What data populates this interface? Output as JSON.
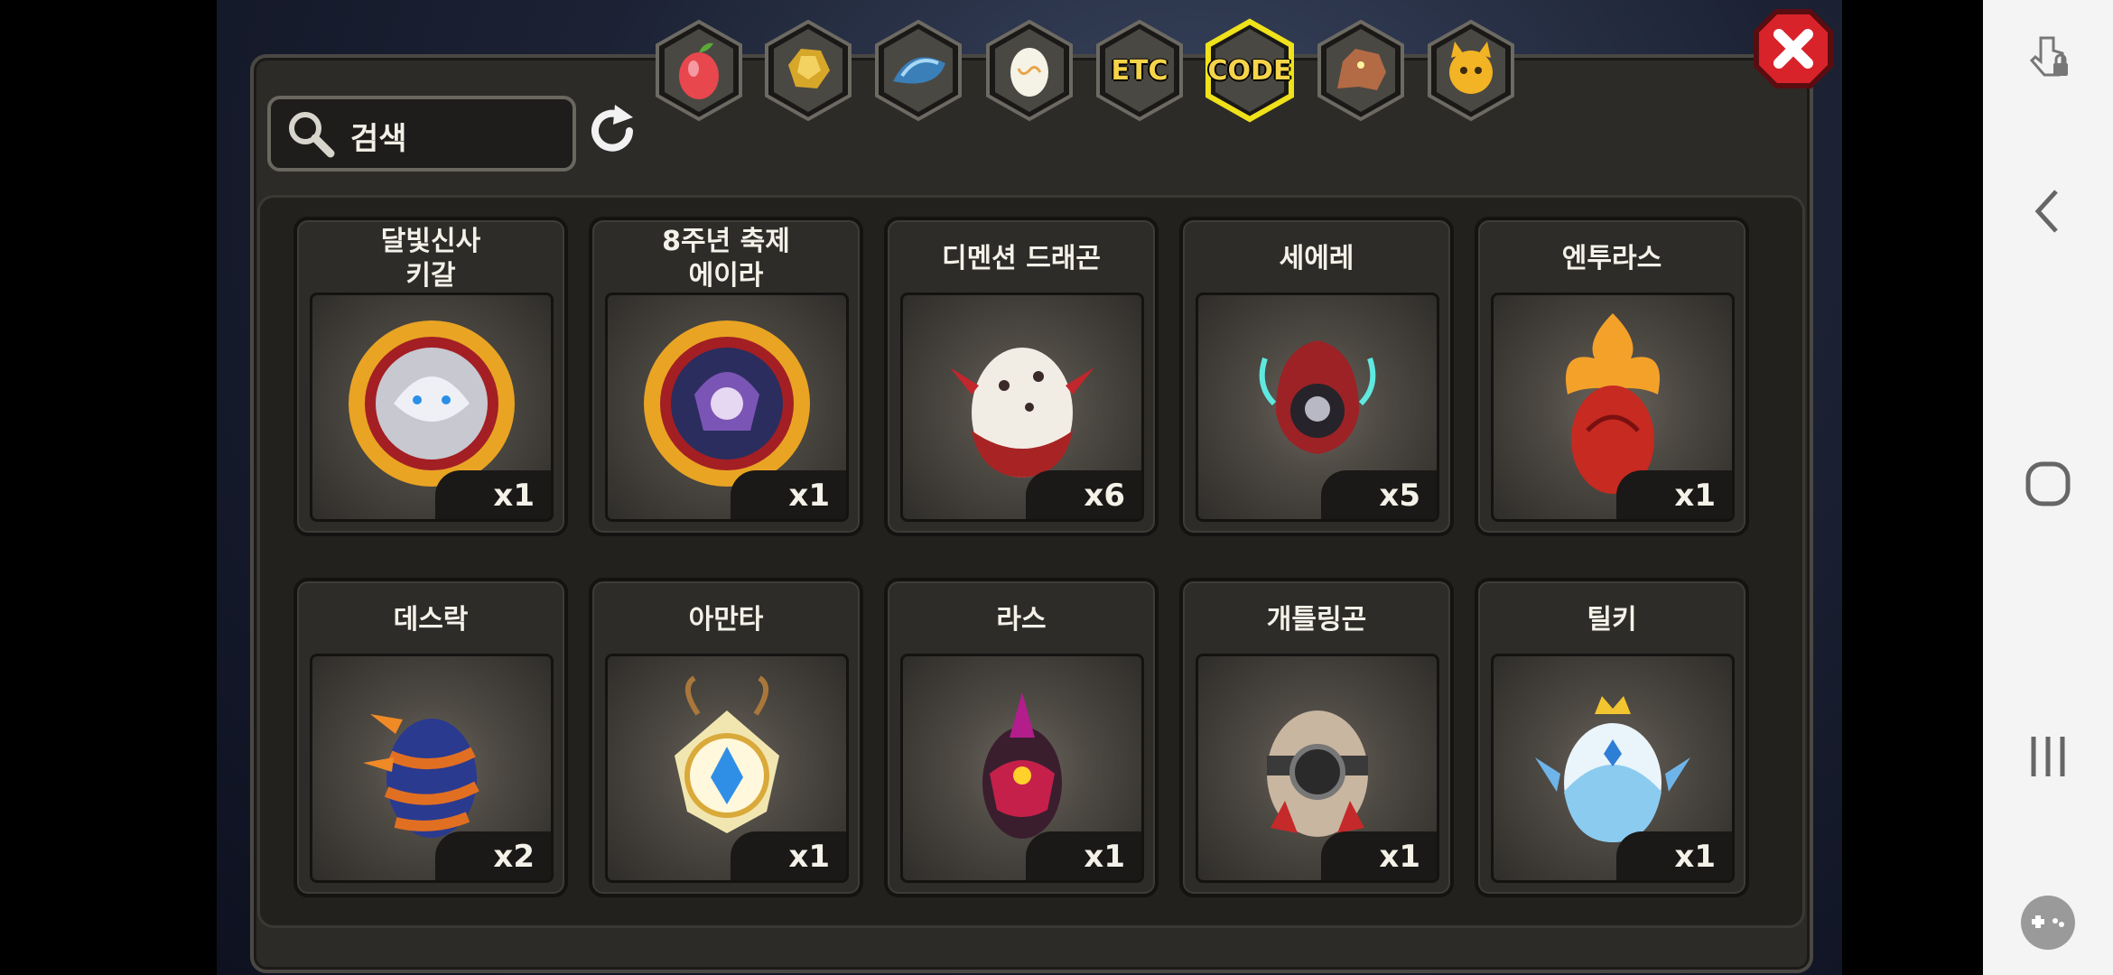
{
  "search": {
    "placeholder": "검색"
  },
  "tabs": [
    {
      "id": "fruit",
      "icon": "fruit-icon",
      "label": ""
    },
    {
      "id": "gold",
      "icon": "gold-ore-icon",
      "label": ""
    },
    {
      "id": "scale",
      "icon": "dragon-scale-icon",
      "label": ""
    },
    {
      "id": "egg",
      "icon": "egg-icon",
      "label": ""
    },
    {
      "id": "etc",
      "icon": "",
      "label": "ETC"
    },
    {
      "id": "code",
      "icon": "",
      "label": "CODE",
      "selected": true
    },
    {
      "id": "dragon",
      "icon": "dragon-head-icon",
      "label": ""
    },
    {
      "id": "face",
      "icon": "creature-face-icon",
      "label": ""
    }
  ],
  "items": [
    {
      "name": "달빛신사\n키갈",
      "qty": "x1",
      "icon": "kigal-medallion-icon"
    },
    {
      "name": "8주년 축제\n에이라",
      "qty": "x1",
      "icon": "eira-medallion-icon"
    },
    {
      "name": "디멘션 드래곤",
      "qty": "x6",
      "icon": "dimension-dragon-egg-icon"
    },
    {
      "name": "세에레",
      "qty": "x5",
      "icon": "seere-egg-icon"
    },
    {
      "name": "엔투라스",
      "qty": "x1",
      "icon": "enturas-egg-icon"
    },
    {
      "name": "데스락",
      "qty": "x2",
      "icon": "deathrock-egg-icon"
    },
    {
      "name": "아만타",
      "qty": "x1",
      "icon": "amanta-egg-icon"
    },
    {
      "name": "라스",
      "qty": "x1",
      "icon": "ras-egg-icon"
    },
    {
      "name": "개틀링곤",
      "qty": "x1",
      "icon": "gatlinggon-egg-icon"
    },
    {
      "name": "틸키",
      "qty": "x1",
      "icon": "tilki-egg-icon"
    }
  ],
  "colors": {
    "panel": "#2c2b28",
    "tab_selected_border": "#f0e21a",
    "close": "#d9232a",
    "navbar": "#f4f4f4"
  },
  "navbar": {
    "icons": [
      "touch-lock-icon",
      "back-icon",
      "home-icon",
      "recent-apps-icon",
      "gamepad-icon"
    ]
  }
}
